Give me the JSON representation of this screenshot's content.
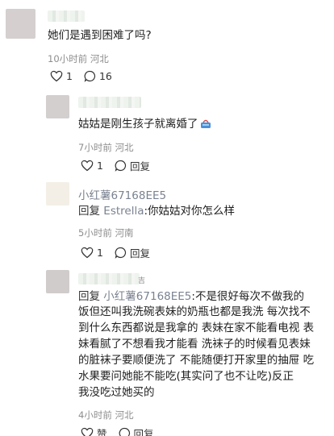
{
  "comment1": {
    "text": "她们是遇到困难了吗?",
    "meta": "10小时前 河北",
    "likes": "1",
    "replies": "16"
  },
  "reply1": {
    "text": "姑姑是刚生孩子就离婚了",
    "emoji": "handbag-emoji",
    "meta": "7小时前 河北",
    "likes": "1",
    "reply_label": "回复"
  },
  "reply2": {
    "username": "小红薯67168EE5",
    "prefix": "回复 ",
    "target": "Estrella",
    "body": ":你姑姑对你怎么样",
    "meta": "5小时前 河南",
    "likes": "1",
    "reply_label": "回复"
  },
  "reply3": {
    "name_fragment": "吉",
    "prefix": "回复 ",
    "target": "小红薯67168EE5",
    "lines": [
      ":不是很好每次不做我的",
      "饭但还叫我洗碗表妹的奶瓶也都是我洗 每次找不",
      "到什么东西都说是我拿的 表妹在家不能看电视 表",
      "妹看腻了不想看我才能看 洗袜子的时候看见表妹",
      "的脏袜子要顺便洗了 不能随便打开家里的抽屉 吃",
      "水果要问她能不能吃(其实问了也不让吃)反正",
      "我没吃过她买的"
    ],
    "meta": "4小时前 河北",
    "like_label": "赞",
    "reply_label": "回复"
  }
}
